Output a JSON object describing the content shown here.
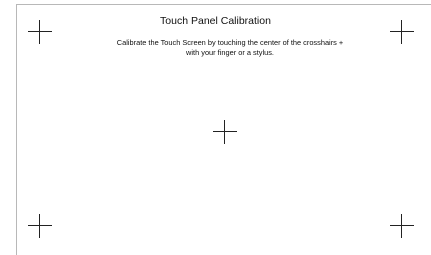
{
  "calibration": {
    "title": "Touch Panel Calibration",
    "instructions_line1": "Calibrate the Touch Screen by touching the center of the crosshairs +",
    "instructions_line2": "with your finger or a stylus."
  },
  "crosshairs": [
    {
      "name": "top-left"
    },
    {
      "name": "top-right"
    },
    {
      "name": "center"
    },
    {
      "name": "bottom-left"
    },
    {
      "name": "bottom-right"
    }
  ],
  "colors": {
    "background": "#ffffff",
    "crosshair": "#222222",
    "text": "#111111",
    "frame": "#b8b8b8"
  }
}
